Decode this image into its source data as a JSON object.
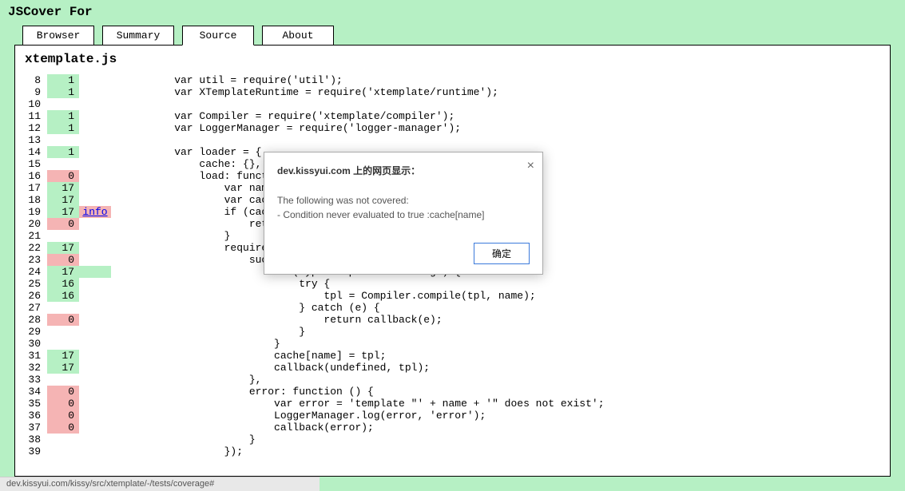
{
  "app_title": "JSCover For",
  "tabs": [
    {
      "label": "Browser",
      "active": false
    },
    {
      "label": "Summary",
      "active": false
    },
    {
      "label": "Source",
      "active": true
    },
    {
      "label": "About",
      "active": false
    }
  ],
  "file_name": "xtemplate.js",
  "info_label": "info",
  "code_lines": [
    {
      "n": 8,
      "cov": 1,
      "kind": "hit",
      "info": null,
      "src": "    var util = require('util');"
    },
    {
      "n": 9,
      "cov": 1,
      "kind": "hit",
      "info": null,
      "src": "    var XTemplateRuntime = require('xtemplate/runtime');"
    },
    {
      "n": 10,
      "cov": null,
      "kind": null,
      "info": null,
      "src": ""
    },
    {
      "n": 11,
      "cov": 1,
      "kind": "hit",
      "info": null,
      "src": "    var Compiler = require('xtemplate/compiler');"
    },
    {
      "n": 12,
      "cov": 1,
      "kind": "hit",
      "info": null,
      "src": "    var LoggerManager = require('logger-manager');"
    },
    {
      "n": 13,
      "cov": null,
      "kind": null,
      "info": null,
      "src": ""
    },
    {
      "n": 14,
      "cov": 1,
      "kind": "hit",
      "info": null,
      "src": "    var loader = {"
    },
    {
      "n": 15,
      "cov": null,
      "kind": null,
      "info": null,
      "src": "        cache: {},"
    },
    {
      "n": 16,
      "cov": 0,
      "kind": "miss",
      "info": null,
      "src": "        load: function (params, callback) {"
    },
    {
      "n": 17,
      "cov": 17,
      "kind": "hit",
      "info": null,
      "src": "            var name = params.name;"
    },
    {
      "n": 18,
      "cov": 17,
      "kind": "hit",
      "info": null,
      "src": "            var cache = this.cache;"
    },
    {
      "n": 19,
      "cov": 17,
      "kind": "hit",
      "info": "link",
      "src": "            if (cache[name]) {"
    },
    {
      "n": 20,
      "cov": 0,
      "kind": "miss",
      "info": null,
      "src": "                return callback(undefined, cache[name]);"
    },
    {
      "n": 21,
      "cov": null,
      "kind": null,
      "info": null,
      "src": "            }"
    },
    {
      "n": 22,
      "cov": 17,
      "kind": "hit",
      "info": null,
      "src": "            require([name], {"
    },
    {
      "n": 23,
      "cov": 0,
      "kind": "miss",
      "info": null,
      "src": "                success: function (tpl) {"
    },
    {
      "n": 24,
      "cov": 17,
      "kind": "hit",
      "info": "bar",
      "src": "                    if (typeof tpl === 'string') {"
    },
    {
      "n": 25,
      "cov": 16,
      "kind": "hit",
      "info": null,
      "src": "                        try {"
    },
    {
      "n": 26,
      "cov": 16,
      "kind": "hit",
      "info": null,
      "src": "                            tpl = Compiler.compile(tpl, name);"
    },
    {
      "n": 27,
      "cov": null,
      "kind": null,
      "info": null,
      "src": "                        } catch (e) {"
    },
    {
      "n": 28,
      "cov": 0,
      "kind": "miss",
      "info": null,
      "src": "                            return callback(e);"
    },
    {
      "n": 29,
      "cov": null,
      "kind": null,
      "info": null,
      "src": "                        }"
    },
    {
      "n": 30,
      "cov": null,
      "kind": null,
      "info": null,
      "src": "                    }"
    },
    {
      "n": 31,
      "cov": 17,
      "kind": "hit",
      "info": null,
      "src": "                    cache[name] = tpl;"
    },
    {
      "n": 32,
      "cov": 17,
      "kind": "hit",
      "info": null,
      "src": "                    callback(undefined, tpl);"
    },
    {
      "n": 33,
      "cov": null,
      "kind": null,
      "info": null,
      "src": "                },"
    },
    {
      "n": 34,
      "cov": 0,
      "kind": "miss",
      "info": null,
      "src": "                error: function () {"
    },
    {
      "n": 35,
      "cov": 0,
      "kind": "miss",
      "info": null,
      "src": "                    var error = 'template \"' + name + '\" does not exist';"
    },
    {
      "n": 36,
      "cov": 0,
      "kind": "miss",
      "info": null,
      "src": "                    LoggerManager.log(error, 'error');"
    },
    {
      "n": 37,
      "cov": 0,
      "kind": "miss",
      "info": null,
      "src": "                    callback(error);"
    },
    {
      "n": 38,
      "cov": null,
      "kind": null,
      "info": null,
      "src": "                }"
    },
    {
      "n": 39,
      "cov": null,
      "kind": null,
      "info": null,
      "src": "            });"
    }
  ],
  "dialog": {
    "title": "dev.kissyui.com 上的网页显示：",
    "body_line1": "The following was not covered:",
    "body_line2": "- Condition never evaluated to true :cache[name]",
    "ok_label": "确定",
    "close_glyph": "×"
  },
  "status_url": "dev.kissyui.com/kissy/src/xtemplate/-/tests/coverage#"
}
